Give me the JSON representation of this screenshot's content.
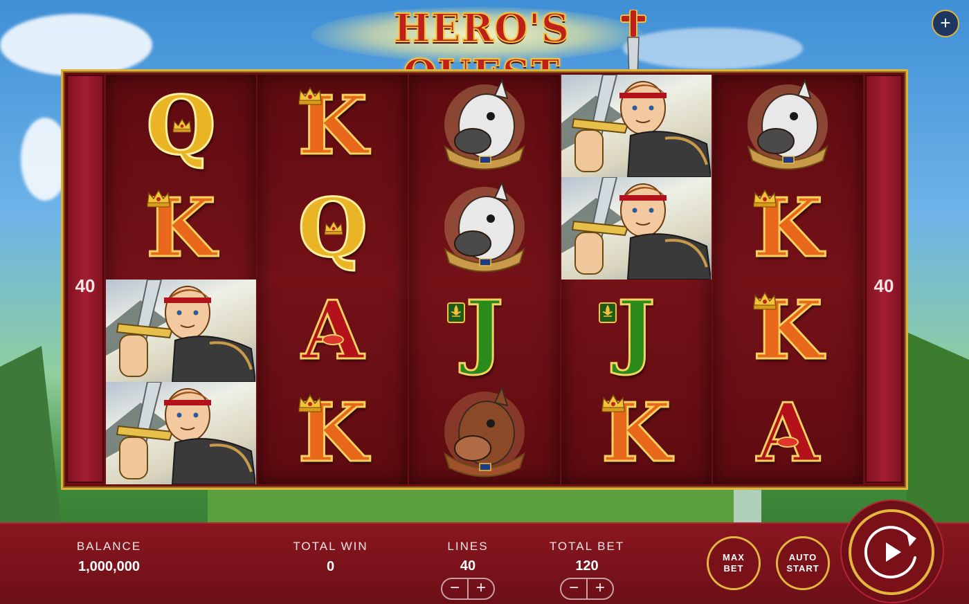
{
  "game": {
    "title": "HERO'S QUEST",
    "menu_button_label": "+"
  },
  "reels": {
    "left_line_count": "40",
    "right_line_count": "40",
    "columns": [
      [
        "Q",
        "K",
        "hero",
        "hero"
      ],
      [
        "K",
        "Q",
        "A",
        "K"
      ],
      [
        "horse",
        "horse",
        "J",
        "boar"
      ],
      [
        "hero",
        "hero",
        "J",
        "K"
      ],
      [
        "horse",
        "K",
        "K",
        "A"
      ]
    ]
  },
  "bottom_bar": {
    "balance_label": "BALANCE",
    "balance_value": "1,000,000",
    "total_win_label": "TOTAL WIN",
    "total_win_value": "0",
    "lines_label": "LINES",
    "lines_value": "40",
    "total_bet_label": "TOTAL BET",
    "total_bet_value": "120",
    "minus_symbol": "−",
    "plus_symbol": "+",
    "max_bet_label_1": "MAX",
    "max_bet_label_2": "BET",
    "auto_start_label_1": "AUTO",
    "auto_start_label_2": "START"
  },
  "colors": {
    "gold": "#e3b63e",
    "burgundy": "#7a1018",
    "queen": "#e9b426",
    "king": "#e8671a",
    "ace": "#b3121b",
    "jack": "#2b8a1c"
  },
  "icons": [
    "plus-icon",
    "sword-icon",
    "crown-icon",
    "fleur-de-lis-icon",
    "lips-icon",
    "spin-icon"
  ]
}
